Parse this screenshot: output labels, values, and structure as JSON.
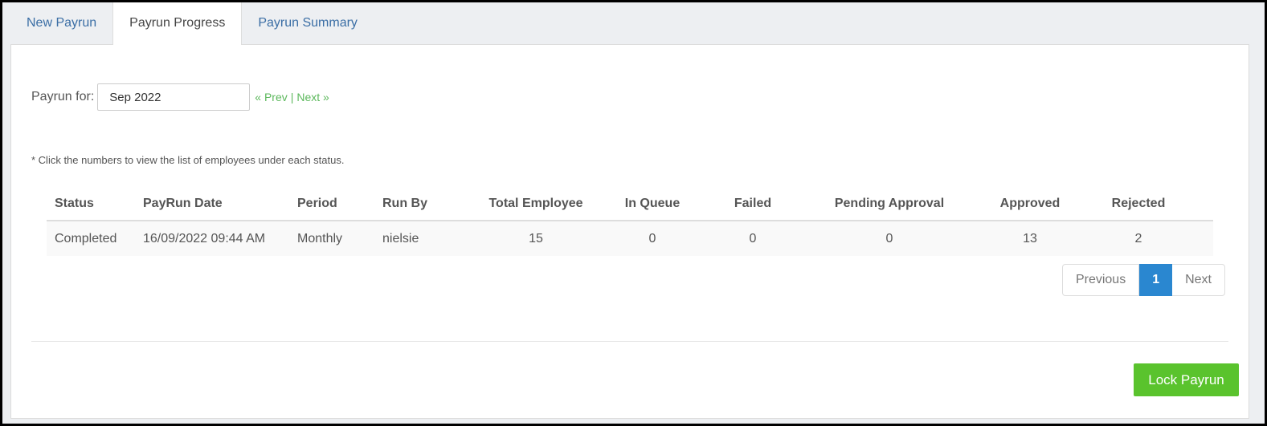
{
  "tabs": [
    {
      "label": "New Payrun"
    },
    {
      "label": "Payrun Progress"
    },
    {
      "label": "Payrun Summary"
    }
  ],
  "payrun": {
    "label": "Payrun for:",
    "month_value": "Sep 2022",
    "prev_label": "« Prev",
    "separator": "|",
    "next_label": "Next »"
  },
  "hint": "* Click the numbers to view the list of employees under each status.",
  "table": {
    "headers": [
      "Status",
      "PayRun Date",
      "Period",
      "Run By",
      "Total Employee",
      "In Queue",
      "Failed",
      "Pending Approval",
      "Approved",
      "Rejected"
    ],
    "rows": [
      {
        "status": "Completed",
        "date": "16/09/2022 09:44 AM",
        "period": "Monthly",
        "run_by": "nielsie",
        "total": "15",
        "in_queue": "0",
        "failed": "0",
        "pending": "0",
        "approved": "13",
        "rejected": "2"
      }
    ]
  },
  "pagination": {
    "previous": "Previous",
    "current": "1",
    "next": "Next"
  },
  "lock_button": "Lock Payrun",
  "colors": {
    "accent_green": "#5cb85c",
    "link_blue": "#3b6ea5",
    "rejected_red": "#d9534f",
    "page_active": "#2a87d0",
    "lock_button": "#5ac32d"
  }
}
